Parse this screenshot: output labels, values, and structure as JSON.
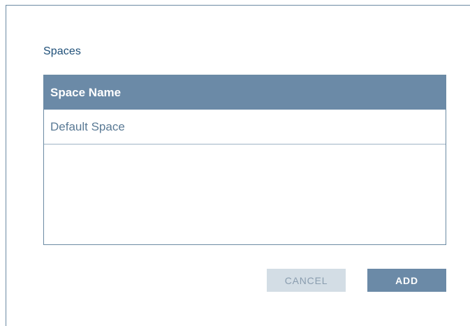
{
  "section": {
    "title": "Spaces"
  },
  "table": {
    "columns": [
      "Space Name"
    ],
    "rows": [
      {
        "space_name": "Default Space"
      }
    ]
  },
  "actions": {
    "cancel_label": "CANCEL",
    "add_label": "ADD"
  },
  "colors": {
    "header_bg": "#6b8aa7",
    "title_text": "#1e4f78",
    "cancel_bg": "#d3dde5",
    "add_bg": "#6b8aa7"
  }
}
